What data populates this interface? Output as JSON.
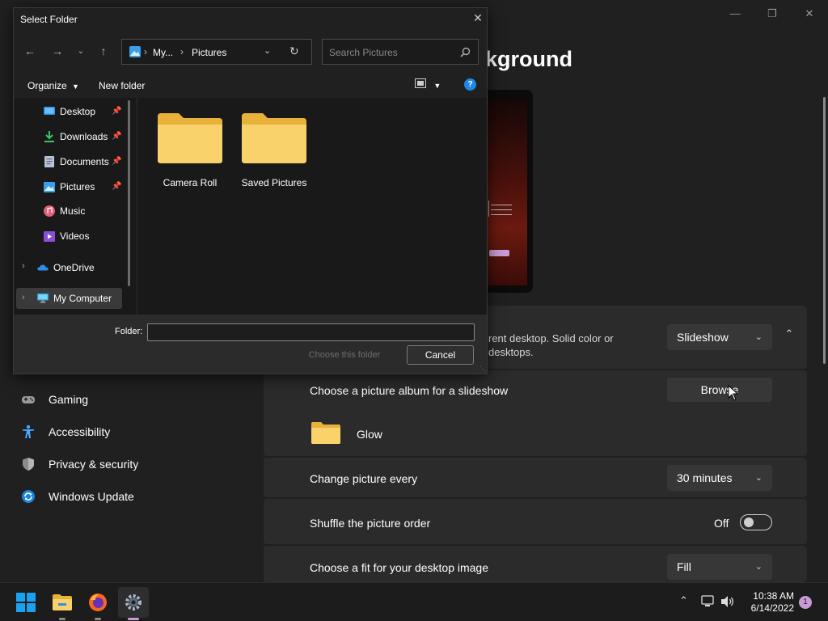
{
  "settings": {
    "title_visible": "kground",
    "window_controls": {
      "minimize": "—",
      "maximize": "❐",
      "close": "✕"
    },
    "background_row": {
      "description_line1": "rent desktop. Solid color or",
      "description_line2": "desktops.",
      "value": "Slideshow"
    },
    "album_row": {
      "label": "Choose a picture album for a slideshow",
      "button": "Browse"
    },
    "album_folder": {
      "name": "Glow"
    },
    "interval_row": {
      "label": "Change picture every",
      "value": "30 minutes"
    },
    "shuffle_row": {
      "label": "Shuffle the picture order",
      "state": "Off"
    },
    "fit_row": {
      "label": "Choose a fit for your desktop image",
      "value": "Fill"
    },
    "nav": [
      {
        "label": "Gaming",
        "icon": "gamepad-icon"
      },
      {
        "label": "Accessibility",
        "icon": "accessibility-icon"
      },
      {
        "label": "Privacy & security",
        "icon": "shield-icon"
      },
      {
        "label": "Windows Update",
        "icon": "update-icon"
      }
    ]
  },
  "dialog": {
    "title": "Select Folder",
    "address": {
      "parent": "My...",
      "current": "Pictures"
    },
    "search_placeholder": "Search Pictures",
    "toolbar": {
      "organize": "Organize",
      "new_folder": "New folder"
    },
    "tree": [
      {
        "label": "Desktop",
        "icon": "desktop-icon",
        "pinned": true
      },
      {
        "label": "Downloads",
        "icon": "downloads-icon",
        "pinned": true
      },
      {
        "label": "Documents",
        "icon": "documents-icon",
        "pinned": true
      },
      {
        "label": "Pictures",
        "icon": "pictures-icon",
        "pinned": true
      },
      {
        "label": "Music",
        "icon": "music-icon",
        "pinned": false
      },
      {
        "label": "Videos",
        "icon": "videos-icon",
        "pinned": false
      },
      {
        "label": "OneDrive",
        "icon": "onedrive-icon",
        "pinned": false
      },
      {
        "label": "My Computer",
        "icon": "computer-icon",
        "pinned": false,
        "selected": true
      }
    ],
    "folders": [
      {
        "name": "Camera Roll"
      },
      {
        "name": "Saved Pictures"
      }
    ],
    "folder_label": "Folder:",
    "folder_value": "",
    "choose_button": "Choose this folder",
    "cancel_button": "Cancel"
  },
  "taskbar": {
    "time": "10:38 AM",
    "date": "6/14/2022",
    "notification_count": "1",
    "apps": [
      "start-icon",
      "file-explorer-icon",
      "firefox-icon",
      "settings-icon"
    ]
  },
  "colors": {
    "accent": "#0078d4",
    "folder_yellow": "#f7c948",
    "help_blue": "#1e88e5"
  }
}
